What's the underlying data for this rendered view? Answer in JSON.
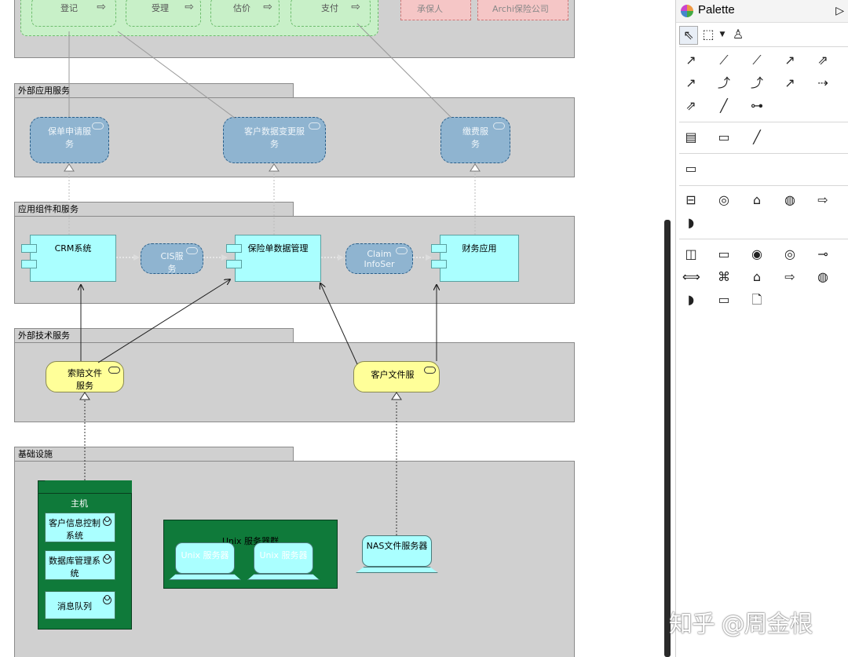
{
  "top_processes": [
    {
      "label": "登记"
    },
    {
      "label": "受理"
    },
    {
      "label": "估价"
    },
    {
      "label": "支付"
    }
  ],
  "top_actors": [
    {
      "label": "承保人"
    },
    {
      "label": "Archi保险公司"
    }
  ],
  "lanes": {
    "external_app": "外部应用服务",
    "app_components": "应用组件和服务",
    "external_tech": "外部技术服务",
    "infrastructure": "基础设施"
  },
  "external_app_services": [
    {
      "label": "保单申请服务"
    },
    {
      "label": "客户数据变更服务"
    },
    {
      "label": "缴费服务"
    }
  ],
  "app_components": {
    "crm": "CRM系统",
    "cis": "CIS服务",
    "policy": "保险单数据管理",
    "claim": "Claim InfoSer",
    "finance": "财务应用"
  },
  "tech_services": {
    "claims_file": "索赔文件服务",
    "customer_file": "客户文件服"
  },
  "infrastructure": {
    "host": "主机",
    "host_items": [
      "客户信息控制系统",
      "数据库管理系统",
      "消息队列"
    ],
    "unix_farm": "Unix 服务器群",
    "unix_servers": [
      "Unix 服务器",
      "Unix 服务器"
    ],
    "nas": "NAS文件服务器"
  },
  "palette": {
    "title": "Palette",
    "expand_glyph": "▷"
  },
  "watermark": "知乎 @周金根",
  "colors": {
    "app_service": "#8fb4d0",
    "tech_service": "#ffff99",
    "app_component": "#aaffff",
    "node_green": "#0f7a3a",
    "lane": "#d0d0d0"
  }
}
